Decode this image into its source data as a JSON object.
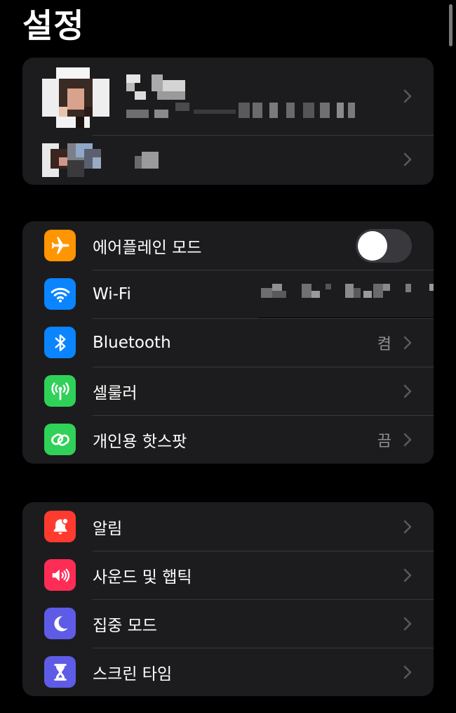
{
  "header": {
    "title": "설정"
  },
  "colors": {
    "background": "#000000",
    "group": "#1c1c1e",
    "separator": "#38383a",
    "secondary_text": "#8e8e93",
    "airplane": "#ff9500",
    "wifi": "#0a84ff",
    "bluetooth": "#0a84ff",
    "cellular": "#30d158",
    "hotspot": "#30d158",
    "notifications": "#ff3b30",
    "sounds": "#ff2d55",
    "focus": "#5e5ce6",
    "screen_time": "#5e5ce6"
  },
  "account": {
    "rows": [
      {
        "kind": "apple-id-profile",
        "blurred": true
      },
      {
        "kind": "family-member",
        "blurred": true
      }
    ]
  },
  "connectivity": {
    "items": [
      {
        "id": "airplane",
        "label": "에어플레인 모드",
        "icon": "airplane-icon",
        "control": "toggle",
        "toggle_on": false
      },
      {
        "id": "wifi",
        "label": "Wi-Fi",
        "icon": "wifi-icon",
        "value_blurred": true
      },
      {
        "id": "bluetooth",
        "label": "Bluetooth",
        "icon": "bluetooth-icon",
        "value": "켬"
      },
      {
        "id": "cellular",
        "label": "셀룰러",
        "icon": "antenna-icon"
      },
      {
        "id": "hotspot",
        "label": "개인용 핫스팟",
        "icon": "link-icon",
        "value": "끔"
      }
    ]
  },
  "system": {
    "items": [
      {
        "id": "notifications",
        "label": "알림",
        "icon": "bell-icon"
      },
      {
        "id": "sounds",
        "label": "사운드 및 햅틱",
        "icon": "speaker-icon"
      },
      {
        "id": "focus",
        "label": "집중 모드",
        "icon": "moon-icon"
      },
      {
        "id": "screen_time",
        "label": "스크린 타임",
        "icon": "hourglass-icon"
      }
    ]
  }
}
